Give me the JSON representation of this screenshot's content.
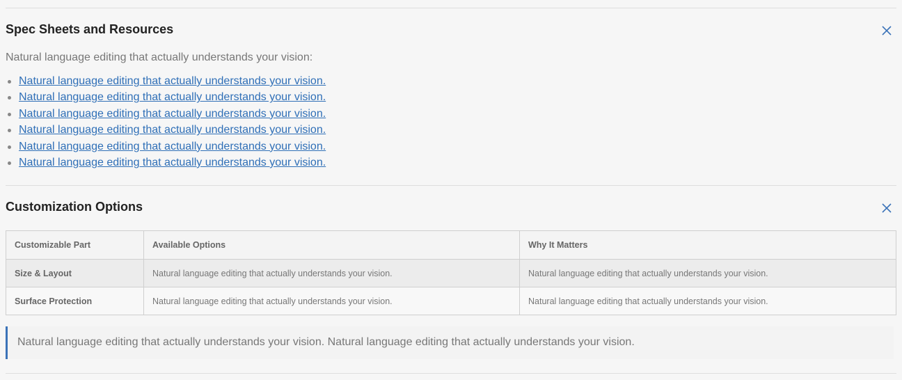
{
  "spec_sheets": {
    "title": "Spec Sheets and Resources",
    "intro": "Natural language editing that actually understands your vision:",
    "links": [
      "Natural language editing that actually understands your vision.",
      "Natural language editing that actually understands your vision.",
      "Natural language editing that actually understands your vision.",
      "Natural language editing that actually understands your vision.",
      "Natural language editing that actually understands your vision.",
      "Natural language editing that actually understands your vision."
    ],
    "close_icon": "close-icon"
  },
  "customization": {
    "title": "Customization Options",
    "close_icon": "close-icon",
    "table": {
      "headers": [
        "Customizable Part",
        "Available Options",
        "Why It Matters"
      ],
      "rows": [
        [
          "Size & Layout",
          "Natural language editing that actually understands your vision.",
          "Natural language editing that actually understands your vision."
        ],
        [
          "Surface Protection",
          "Natural language editing that actually understands your vision.",
          "Natural language editing that actually understands your vision."
        ]
      ]
    },
    "note": "Natural language editing that actually understands your vision. Natural language editing that actually understands your vision."
  },
  "colors": {
    "accent": "#3a72b8",
    "link": "#2f6fb7",
    "background": "#f6f6f6"
  }
}
